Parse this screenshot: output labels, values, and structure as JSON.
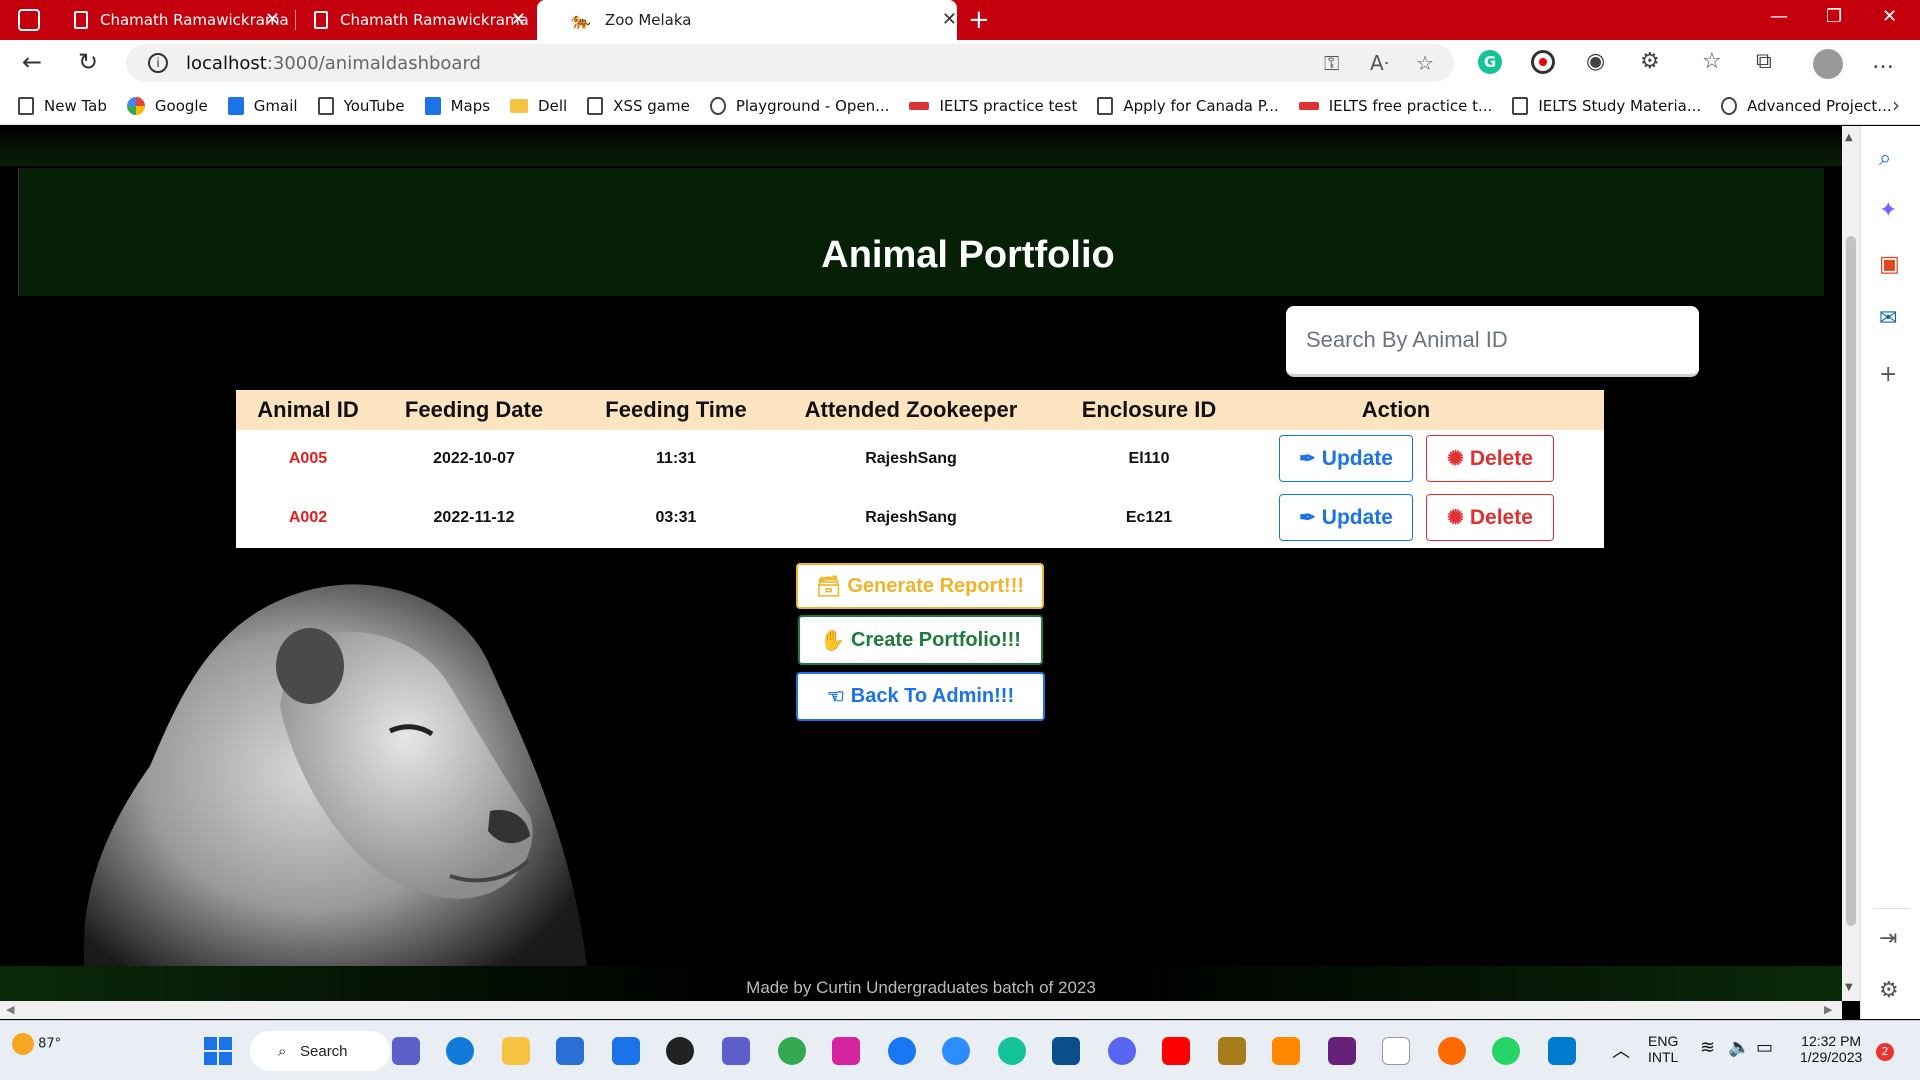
{
  "browser": {
    "tabs": [
      {
        "title": "Chamath Ramawickrama"
      },
      {
        "title": "Chamath Ramawickrama"
      },
      {
        "title": "Zoo Melaka"
      }
    ],
    "url_host": "localhost",
    "url_path": ":3000/animaldashboard",
    "bookmarks": [
      {
        "label": "New Tab",
        "icon": "page-icon"
      },
      {
        "label": "Google",
        "icon": "google-icon"
      },
      {
        "label": "Gmail",
        "icon": "outlook-icon"
      },
      {
        "label": "YouTube",
        "icon": "page-icon"
      },
      {
        "label": "Maps",
        "icon": "maps-icon"
      },
      {
        "label": "Dell",
        "icon": "folder-icon"
      },
      {
        "label": "XSS game",
        "icon": "page-icon"
      },
      {
        "label": "Playground - Open...",
        "icon": "openai-icon"
      },
      {
        "label": "IELTS practice test",
        "icon": "ielts-icon"
      },
      {
        "label": "Apply for Canada P...",
        "icon": "page-icon"
      },
      {
        "label": "IELTS free practice t...",
        "icon": "ielts-icon"
      },
      {
        "label": "IELTS Study Materia...",
        "icon": "page-icon"
      },
      {
        "label": "Advanced Project...",
        "icon": "page-icon"
      }
    ]
  },
  "page": {
    "title": "Animal Portfolio",
    "search_placeholder": "Search By Animal ID",
    "table": {
      "headers": [
        "Animal ID",
        "Feeding Date",
        "Feeding Time",
        "Attended Zookeeper",
        "Enclosure ID",
        "Action"
      ],
      "rows": [
        {
          "animal_id": "A005",
          "feeding_date": "2022-10-07",
          "feeding_time": "11:31",
          "zookeeper": "RajeshSang",
          "enclosure_id": "El110"
        },
        {
          "animal_id": "A002",
          "feeding_date": "2022-11-12",
          "feeding_time": "03:31",
          "zookeeper": "RajeshSang",
          "enclosure_id": "Ec121"
        }
      ],
      "update_label": "Update",
      "delete_label": "Delete"
    },
    "buttons": {
      "generate_report": "Generate Report!!!",
      "create_portfolio": "Create Portfolio!!!",
      "back_to_admin": "Back To Admin!!!"
    },
    "footer": "Made by Curtin Undergraduates batch of 2023"
  },
  "taskbar": {
    "weather_temp": "87°",
    "search_label": "Search",
    "lang_top": "ENG",
    "lang_bottom": "INTL",
    "time": "12:32 PM",
    "date": "1/29/2023",
    "notifications": "2"
  },
  "colors": {
    "browser_tabbar": "#c4000c",
    "header_bg": "#062006",
    "table_header_bg": "#fde4c0",
    "id_red": "#e11d1d",
    "update_blue": "#1a73e8",
    "delete_red": "#e03131",
    "report_yellow": "#f0b429",
    "create_green": "#1e7b3a"
  }
}
